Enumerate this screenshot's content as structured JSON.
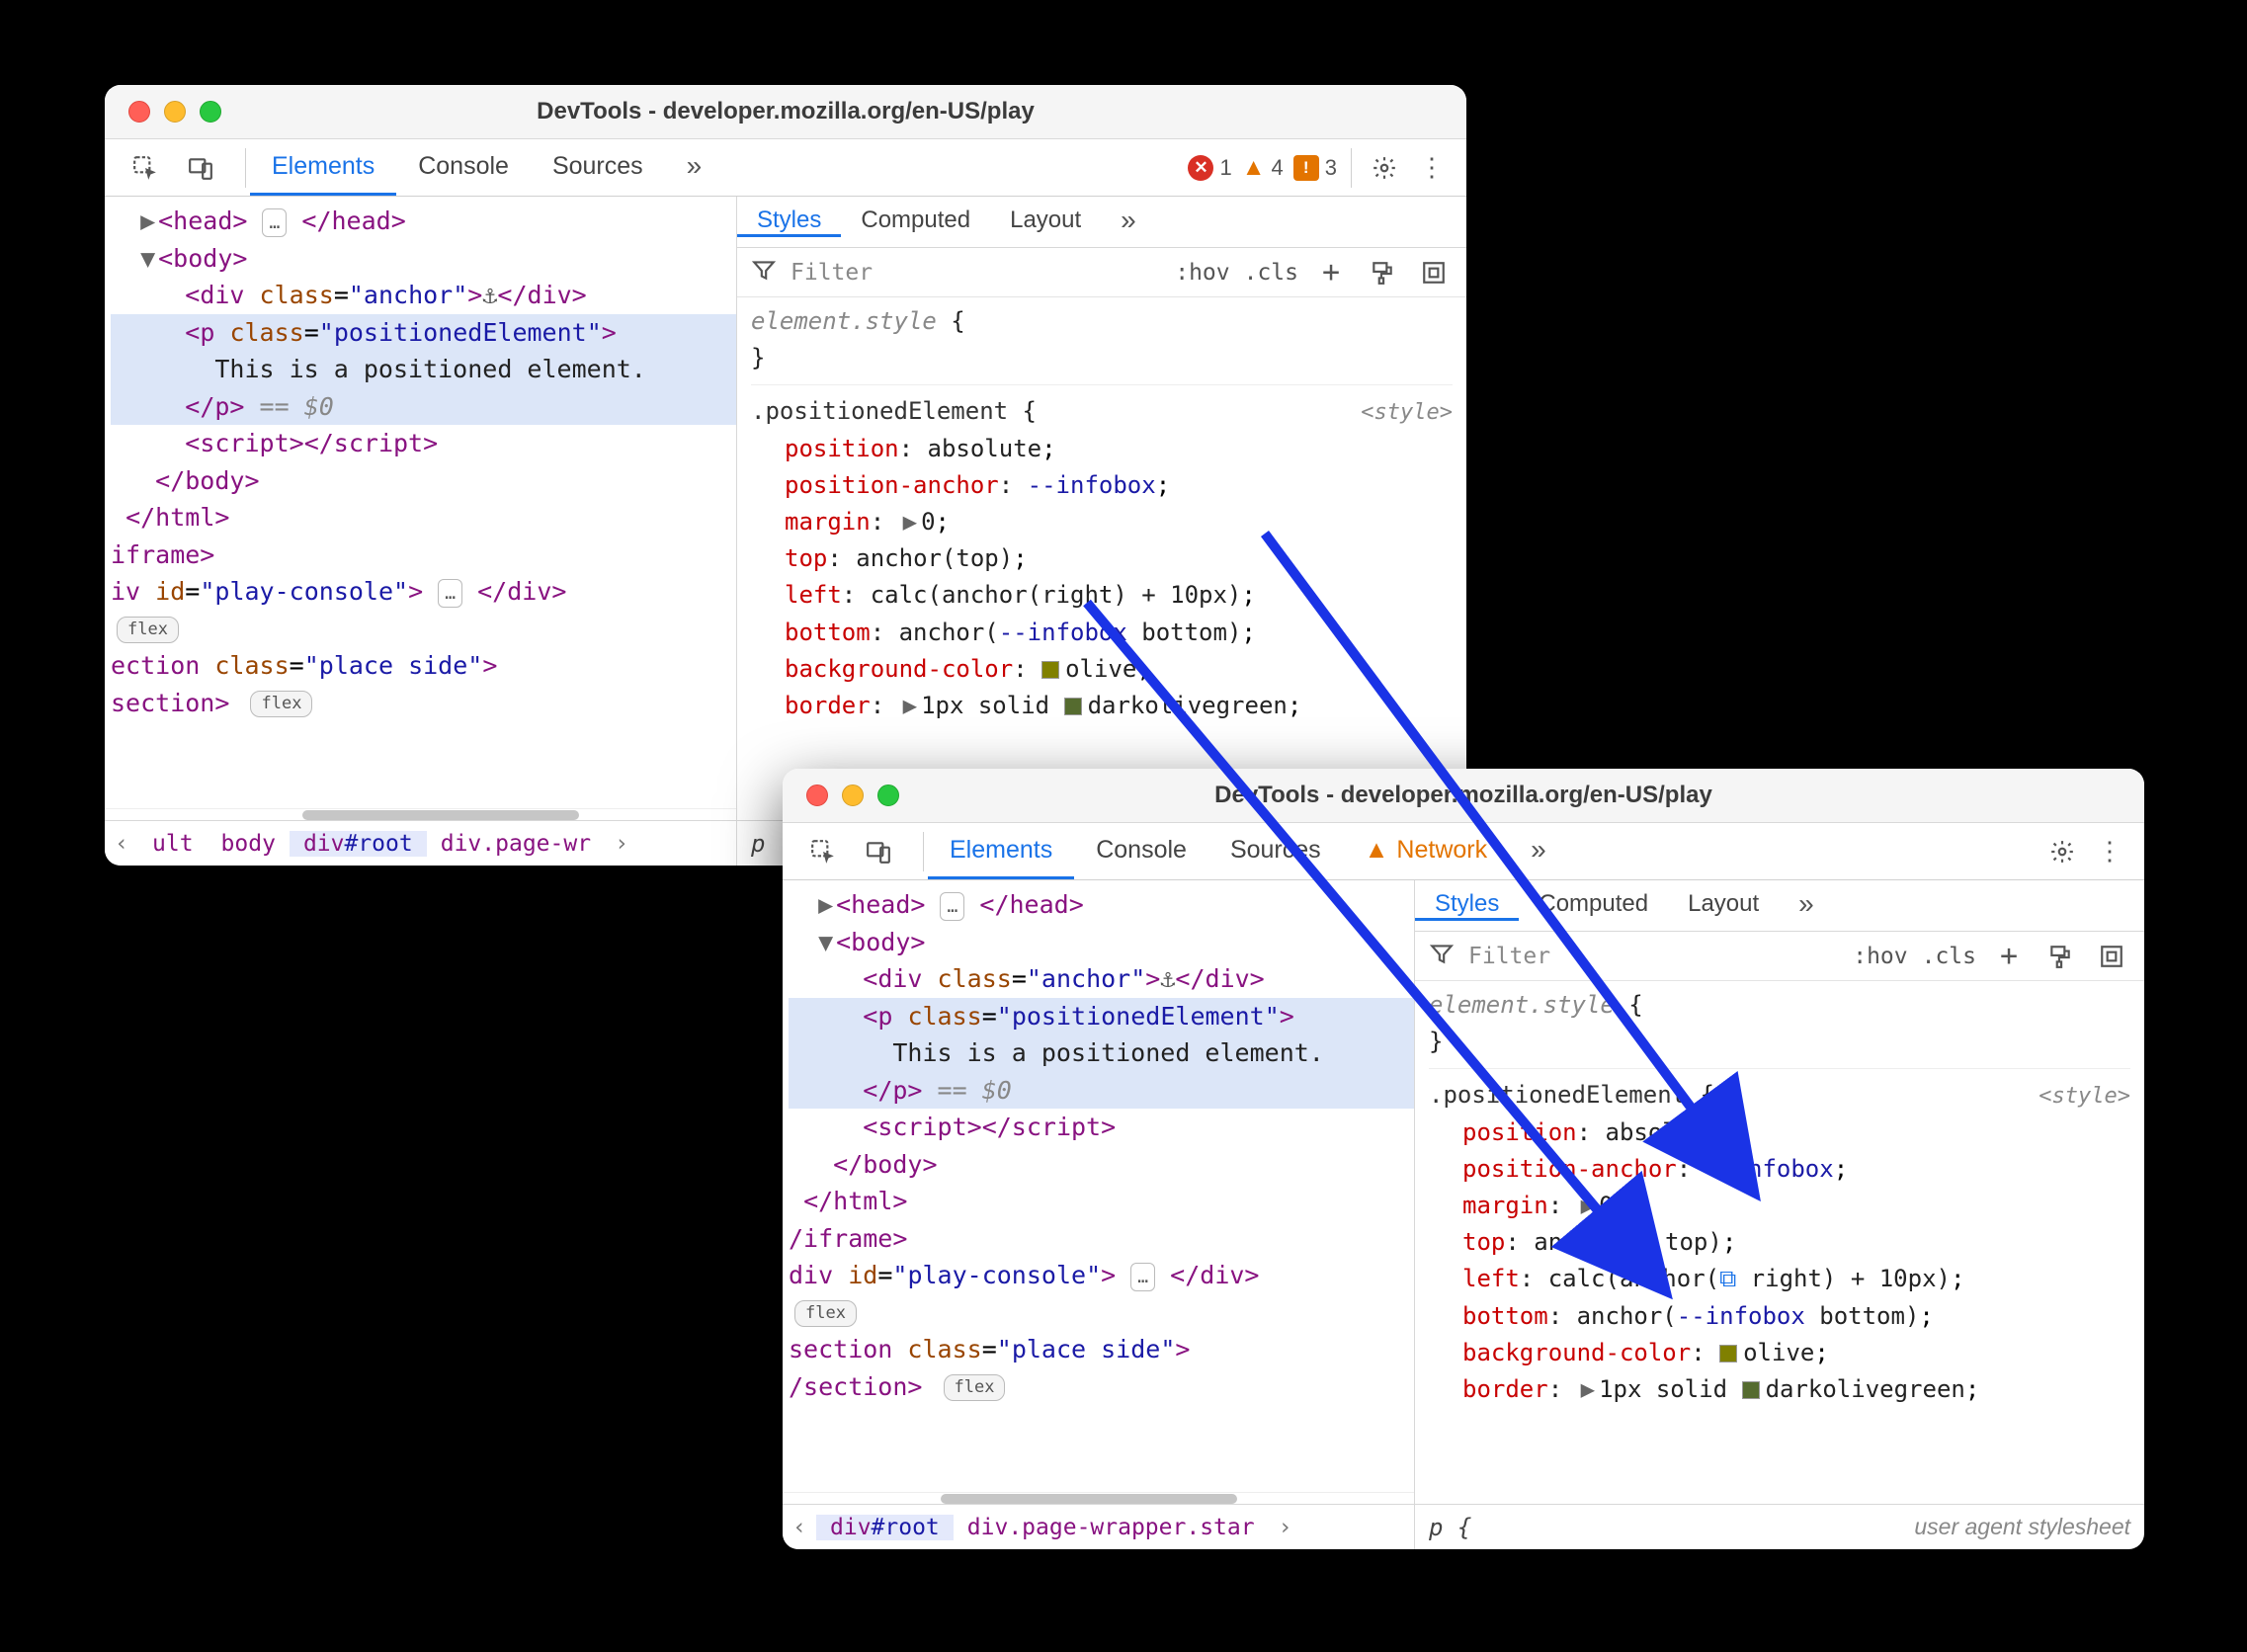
{
  "windows": [
    {
      "title": "DevTools - developer.mozilla.org/en-US/play",
      "tabs": [
        "Elements",
        "Console",
        "Sources"
      ],
      "activeTab": "Elements",
      "issues": {
        "errors": 1,
        "warnings": 4,
        "info": 3
      },
      "stylesTabs": [
        "Styles",
        "Computed",
        "Layout"
      ],
      "activeStylesTab": "Styles",
      "filterPlaceholder": "Filter",
      "filterButtons": [
        ":hov",
        ".cls"
      ],
      "dom": {
        "headBadge": "…",
        "anchorGlyph": "⚓",
        "pClass": "positionedElement",
        "pText": "This is a positioned element.",
        "selHint": "== $0",
        "playConsoleId": "play-console",
        "placeSideClass": "place side",
        "flexLabel": "flex"
      },
      "breadcrumbs": [
        "‹",
        "ult",
        "body",
        "div#root",
        "div.page-wr",
        "›"
      ],
      "breadcrumbsSelectedIndex": 3,
      "rules": {
        "elementStyleLabel": "element.style",
        "ruleSelector": ".positionedElement",
        "ruleSrc": "<style>",
        "props": [
          {
            "name": "position",
            "value": "absolute",
            "kind": "plain"
          },
          {
            "name": "position-anchor",
            "value": "--infobox",
            "kind": "kw"
          },
          {
            "name": "margin",
            "value": "0",
            "kind": "expand"
          },
          {
            "name": "top",
            "value": "anchor(top)",
            "kind": "fn"
          },
          {
            "name": "left",
            "value": "calc(anchor(right) + 10px)",
            "kind": "fn"
          },
          {
            "name": "bottom",
            "value": "anchor(--infobox bottom)",
            "kind": "fn-kw"
          },
          {
            "name": "background-color",
            "value": "olive",
            "swatch": "#808000"
          },
          {
            "name": "border",
            "value": "1px solid darkolivegreen",
            "swatch": "#556b2f",
            "kind": "expand"
          }
        ]
      },
      "bottomStatus": "p"
    },
    {
      "title": "DevTools - developer.mozilla.org/en-US/play",
      "tabs": [
        "Elements",
        "Console",
        "Sources",
        "Network"
      ],
      "activeTab": "Elements",
      "networkWarn": true,
      "stylesTabs": [
        "Styles",
        "Computed",
        "Layout"
      ],
      "activeStylesTab": "Styles",
      "filterPlaceholder": "Filter",
      "filterButtons": [
        ":hov",
        ".cls"
      ],
      "dom": {
        "headBadge": "…",
        "anchorGlyph": "⚓",
        "pClass": "positionedElement",
        "pText": "This is a positioned element.",
        "selHint": "== $0",
        "playConsoleId": "play-console",
        "placeSideClass": "place side",
        "flexLabel": "flex"
      },
      "breadcrumbs": [
        "‹",
        "div#root",
        "div.page-wrapper.star",
        "›"
      ],
      "breadcrumbsSelectedIndex": 1,
      "rules": {
        "elementStyleLabel": "element.style",
        "ruleSelector": ".positionedElement",
        "ruleSrc": "<style>",
        "props": [
          {
            "name": "position",
            "value": "absolute",
            "kind": "plain"
          },
          {
            "name": "position-anchor",
            "value": "--infobox",
            "kind": "kw"
          },
          {
            "name": "margin",
            "value": "0",
            "kind": "expand"
          },
          {
            "name": "top",
            "value_parts": [
              "anchor(",
              "LINK",
              " top)"
            ],
            "kind": "fn-link"
          },
          {
            "name": "left",
            "value_parts": [
              "calc(anchor(",
              "LINK",
              " right) + 10px)"
            ],
            "kind": "fn-link"
          },
          {
            "name": "bottom",
            "value": "anchor(--infobox bottom)",
            "kind": "fn-kw"
          },
          {
            "name": "background-color",
            "value": "olive",
            "swatch": "#808000"
          },
          {
            "name": "border",
            "value": "1px solid darkolivegreen",
            "swatch": "#556b2f",
            "kind": "expand"
          }
        ]
      },
      "bottomStatus": "p {",
      "uaStylesheet": "user agent stylesheet"
    }
  ]
}
